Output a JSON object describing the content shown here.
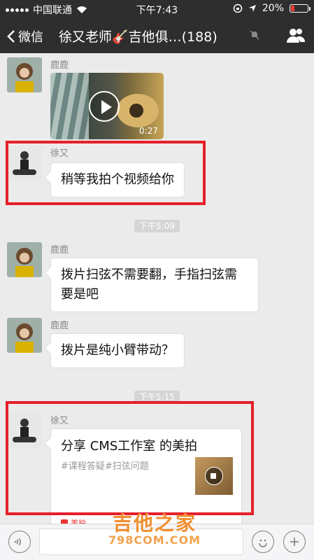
{
  "status_bar": {
    "carrier": "中国联通",
    "time": "下午7:43",
    "battery": "20%",
    "battery_level": 0.2
  },
  "nav": {
    "back_label": "微信",
    "title": "徐又老师🎸吉他俱…(188)"
  },
  "messages": [
    {
      "sender": "鹿鹿",
      "type": "video",
      "duration": "0:27"
    },
    {
      "sender": "徐又",
      "type": "text",
      "text": "稍等我拍个视频给你"
    },
    {
      "type": "time",
      "text": "下午5:09"
    },
    {
      "sender": "鹿鹿",
      "type": "text",
      "text": "拨片扫弦不需要翻，手指扫弦需要是吧"
    },
    {
      "sender": "鹿鹿",
      "type": "text",
      "text": "拨片是纯小臂带动？"
    },
    {
      "type": "time",
      "text": "下午5:15"
    },
    {
      "sender": "徐又",
      "type": "share",
      "title": "分享 CMS工作室 的美拍",
      "desc": "#课程答疑#扫弦问题",
      "source": "美拍"
    }
  ],
  "watermark": {
    "main": "吉他之家",
    "sub": "798COM.COM"
  },
  "colors": {
    "nav_bg": "#2e2e2e",
    "chat_bg": "#ebebeb",
    "highlight": "#e5202a"
  }
}
